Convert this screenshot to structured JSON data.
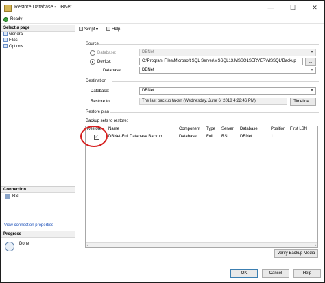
{
  "window": {
    "title": "Restore Database - DBNet",
    "minimize": "—",
    "maximize": "☐",
    "close": "✕"
  },
  "status": {
    "ready": "Ready"
  },
  "left": {
    "select_page": "Select a page",
    "pages": [
      "General",
      "Files",
      "Options"
    ],
    "connection_title": "Connection",
    "connection_server": "RSI",
    "view_connection": "View connection properties",
    "progress_title": "Progress",
    "progress_status": "Done"
  },
  "toolbar": {
    "script": "Script",
    "script_dropdown": "▾",
    "help": "Help"
  },
  "source": {
    "title": "Source",
    "database_label": "Database:",
    "database_value": "DBNet",
    "device_label": "Device:",
    "device_value": "C:\\Program Files\\Microsoft SQL Server\\MSSQL13.MSSQLSERVER\\MSSQL\\Backup",
    "browse": "...",
    "device_database_label": "Database:",
    "device_database_value": "DBNet"
  },
  "destination": {
    "title": "Destination",
    "database_label": "Database:",
    "database_value": "DBNet",
    "restore_to_label": "Restore to:",
    "restore_to_value": "The last backup taken (Wednesday, June 6, 2018 4:22:46 PM)",
    "timeline": "Timeline..."
  },
  "plan": {
    "title": "Restore plan",
    "sets_label": "Backup sets to restore:",
    "columns": [
      "Restore",
      "Name",
      "Component",
      "Type",
      "Server",
      "Database",
      "Position",
      "First LSN"
    ],
    "rows": [
      {
        "restore": "✓",
        "name": "DBNet-Full Database Backup",
        "component": "Database",
        "type": "Full",
        "server": "RSI",
        "database": "DBNet",
        "position": "1",
        "first_lsn": ""
      }
    ],
    "verify": "Verify Backup Media"
  },
  "buttons": {
    "ok": "OK",
    "cancel": "Cancel",
    "help": "Help"
  },
  "dropdown_arrow": "▾",
  "scroll_left": "◂",
  "scroll_right": "▸",
  "colors": {
    "annotation_circle": "#d62020",
    "ready_icon": "#3aa03a",
    "link": "#1a4fb8"
  }
}
